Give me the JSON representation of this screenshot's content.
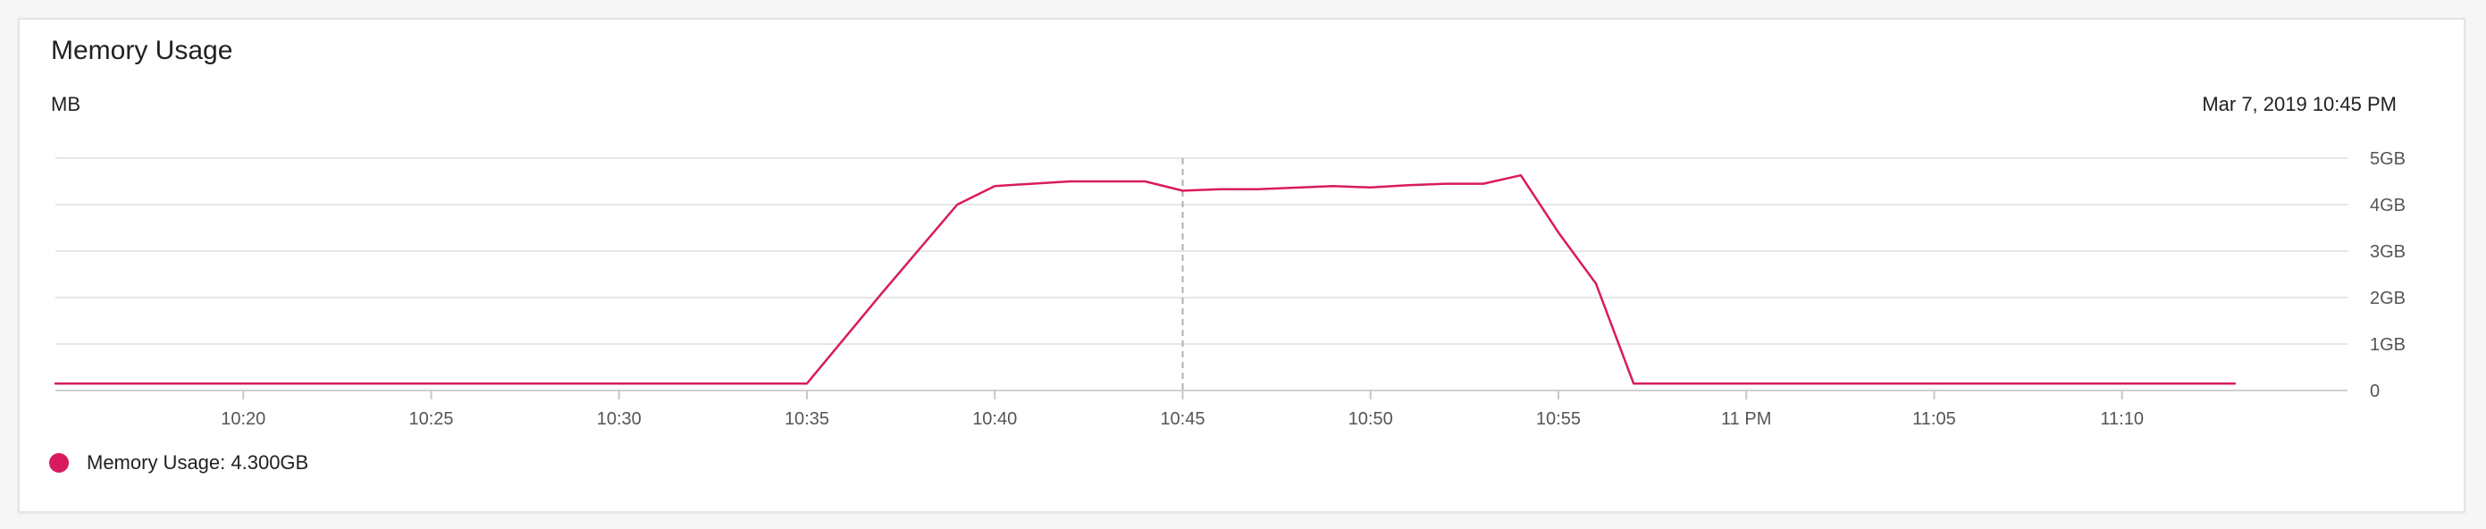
{
  "card": {
    "title": "Memory Usage",
    "unit": "MB",
    "timestamp": "Mar 7, 2019 10:45 PM"
  },
  "legend": {
    "label": "Memory Usage: 4.300GB"
  },
  "colors": {
    "series": "#d81b60",
    "grid": "#e6e6e6",
    "cursor": "#b0b0b0",
    "tick": "#555555"
  },
  "chart_data": {
    "type": "line",
    "title": "Memory Usage",
    "ylabel": "MB",
    "ylim": [
      0,
      5
    ],
    "yticks": [
      {
        "value": 0,
        "label": "0"
      },
      {
        "value": 1,
        "label": "1GB"
      },
      {
        "value": 2,
        "label": "2GB"
      },
      {
        "value": 3,
        "label": "3GB"
      },
      {
        "value": 4,
        "label": "4GB"
      },
      {
        "value": 5,
        "label": "5GB"
      }
    ],
    "xlim": [
      "10:15",
      "11:16"
    ],
    "xticks": [
      {
        "value": "10:20",
        "label": "10:20"
      },
      {
        "value": "10:25",
        "label": "10:25"
      },
      {
        "value": "10:30",
        "label": "10:30"
      },
      {
        "value": "10:35",
        "label": "10:35"
      },
      {
        "value": "10:40",
        "label": "10:40"
      },
      {
        "value": "10:45",
        "label": "10:45"
      },
      {
        "value": "10:50",
        "label": "10:50"
      },
      {
        "value": "10:55",
        "label": "10:55"
      },
      {
        "value": "11:00",
        "label": "11 PM"
      },
      {
        "value": "11:05",
        "label": "11:05"
      },
      {
        "value": "11:10",
        "label": "11:10"
      }
    ],
    "cursor_x": "10:45",
    "legend_position": "bottom-left",
    "grid": true,
    "series": [
      {
        "name": "Memory Usage",
        "x": [
          "10:15",
          "10:35",
          "10:37",
          "10:39",
          "10:40",
          "10:42",
          "10:44",
          "10:45",
          "10:46",
          "10:47",
          "10:49",
          "10:50",
          "10:51",
          "10:52",
          "10:53",
          "10:54",
          "10:55",
          "10:56",
          "10:57",
          "11:13"
        ],
        "y": [
          0.15,
          0.15,
          2.1,
          4.0,
          4.4,
          4.5,
          4.5,
          4.3,
          4.33,
          4.33,
          4.4,
          4.37,
          4.42,
          4.45,
          4.45,
          4.63,
          3.4,
          2.3,
          0.15,
          0.15
        ]
      }
    ]
  }
}
